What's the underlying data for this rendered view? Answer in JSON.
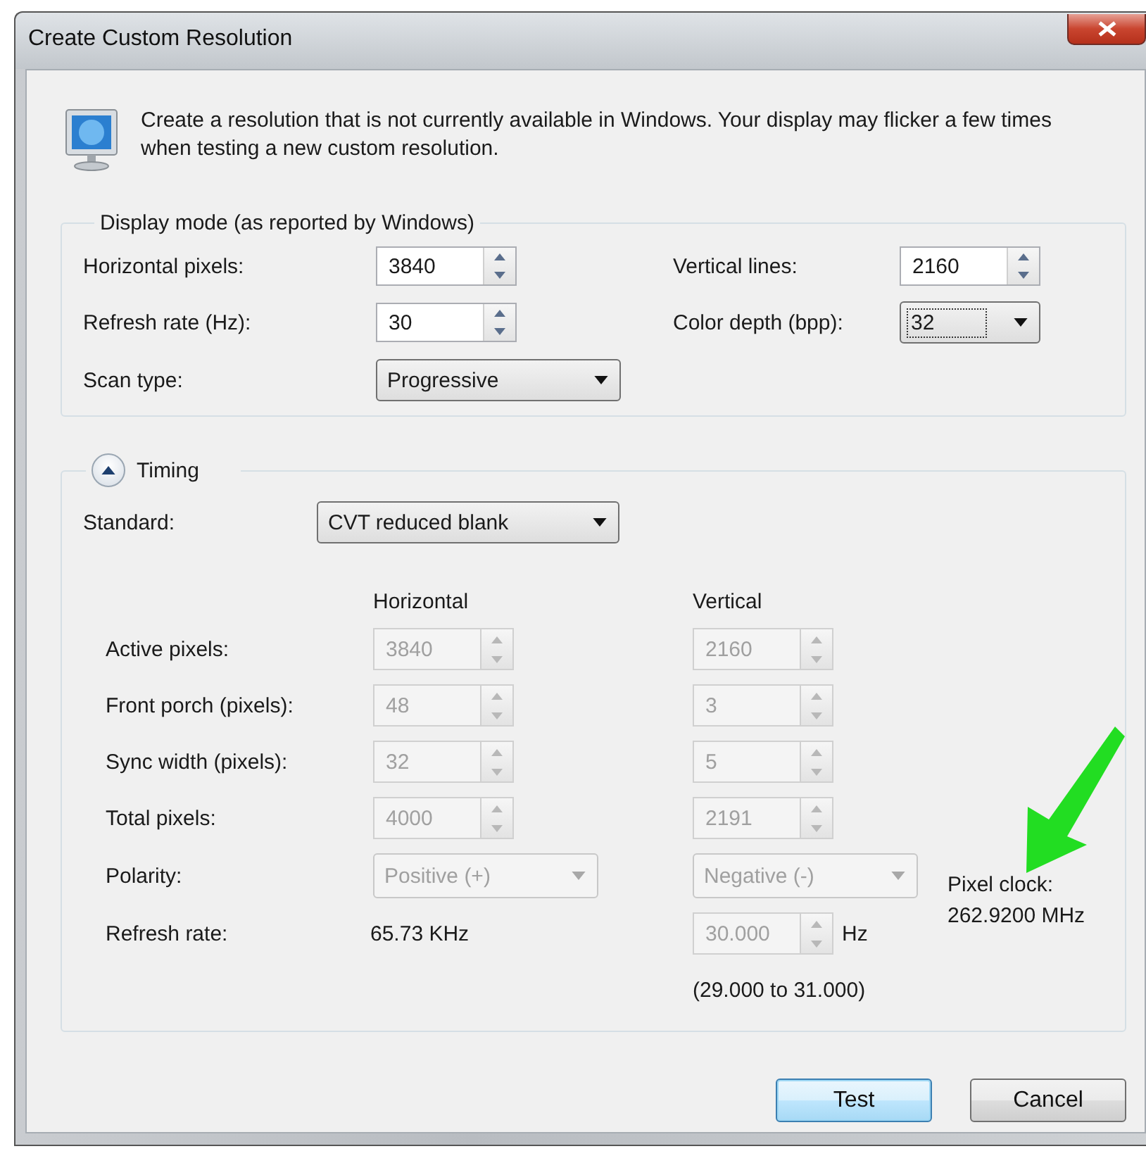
{
  "window": {
    "title": "Create Custom Resolution"
  },
  "intro": "Create a resolution that is not currently available in Windows. Your display may flicker a few times when testing a new custom resolution.",
  "display_mode": {
    "title": "Display mode (as reported by Windows)",
    "left_fields": [
      {
        "label": "Horizontal pixels:",
        "kind": "spin",
        "value": "3840",
        "focused": false
      },
      {
        "label": "Refresh rate (Hz):",
        "kind": "spin",
        "value": "30",
        "focused": false
      },
      {
        "label": "Scan type:",
        "kind": "combo",
        "value": "Progressive",
        "focused": false
      }
    ],
    "right_fields": [
      {
        "label": "Vertical lines:",
        "kind": "spin",
        "value": "2160",
        "focused": false
      },
      {
        "label": "Color depth (bpp):",
        "kind": "combo",
        "value": "32",
        "focused": true
      }
    ]
  },
  "timing": {
    "title": "Timing",
    "expanded": true,
    "disabled": true,
    "standard": {
      "label": "Standard:",
      "value": "CVT reduced blank"
    },
    "columns": [
      "Horizontal",
      "Vertical"
    ],
    "rows": [
      {
        "label": "Active pixels:",
        "kind": "spin",
        "horizontal": "3840",
        "vertical": "2160"
      },
      {
        "label": "Front porch (pixels):",
        "kind": "spin",
        "horizontal": "48",
        "vertical": "3"
      },
      {
        "label": "Sync width (pixels):",
        "kind": "spin",
        "horizontal": "32",
        "vertical": "5"
      },
      {
        "label": "Total pixels:",
        "kind": "spin",
        "horizontal": "4000",
        "vertical": "2191"
      },
      {
        "label": "Polarity:",
        "kind": "combo",
        "horizontal": "Positive (+)",
        "vertical": "Negative (-)"
      },
      {
        "label": "Refresh rate:",
        "kind": "rate",
        "horizontal": "65.73 KHz",
        "vertical": "30.000",
        "unit": "Hz"
      }
    ],
    "range": "(29.000 to 31.000)",
    "pixel_clock": {
      "label": "Pixel clock:",
      "value": "262.9200 MHz"
    }
  },
  "buttons": [
    {
      "label": "Test",
      "default": true
    },
    {
      "label": "Cancel",
      "default": false
    }
  ]
}
